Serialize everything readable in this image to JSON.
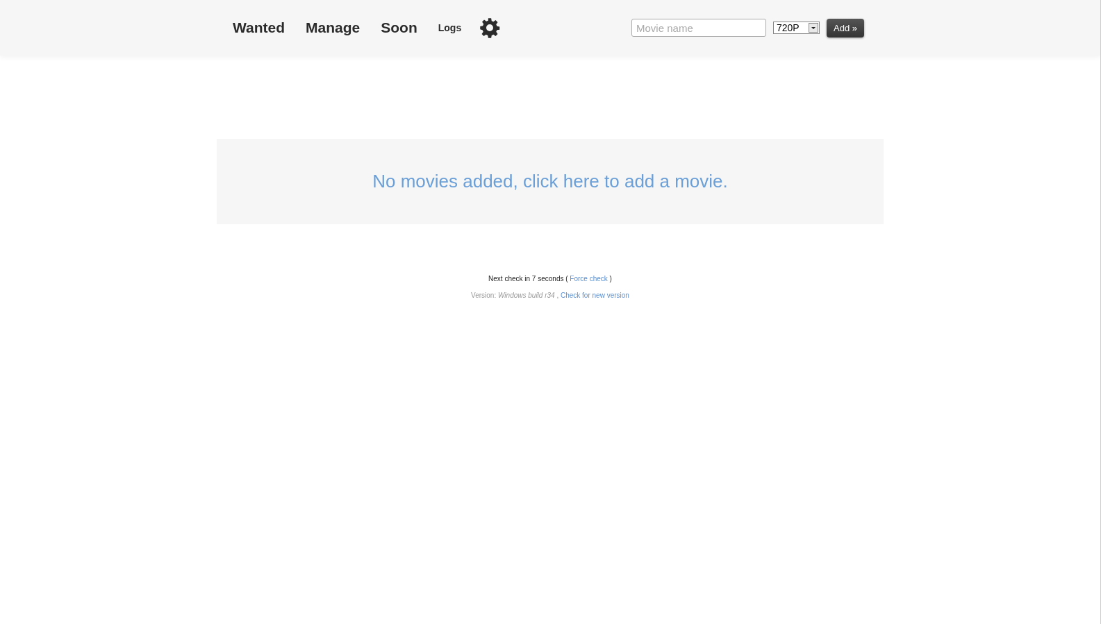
{
  "nav": {
    "items": [
      {
        "label": "Wanted",
        "kind": "main"
      },
      {
        "label": "Manage",
        "kind": "main"
      },
      {
        "label": "Soon",
        "kind": "main"
      },
      {
        "label": "Logs",
        "kind": "small"
      }
    ]
  },
  "add_form": {
    "search": {
      "placeholder": "Movie name"
    },
    "quality": {
      "value": "720P"
    },
    "button": "Add »"
  },
  "empty_message": "No movies added, click here to add a movie.",
  "footer": {
    "next_check": {
      "before": "Next check in 7 seconds (",
      "link": "Force check",
      "after": ")"
    },
    "version": {
      "label": "Version:",
      "build": "Windows build r34",
      "separator": ",",
      "link": "Check for new version"
    }
  }
}
